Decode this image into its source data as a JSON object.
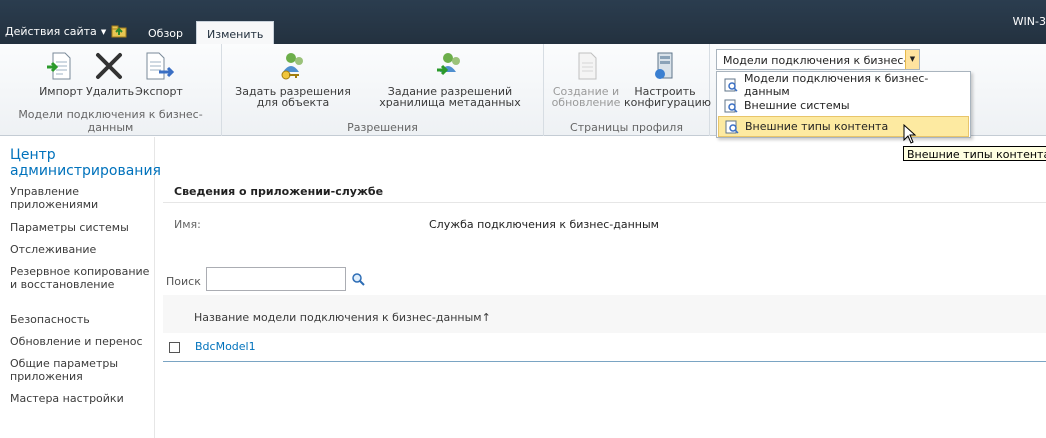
{
  "topbar": {
    "site_actions": "Действия сайта",
    "tabs": [
      {
        "label": "Обзор"
      },
      {
        "label": "Изменить"
      }
    ],
    "server_name": "WIN-3"
  },
  "ribbon": {
    "groups": {
      "models": {
        "title": "Модели подключения к бизнес-данным",
        "import": "Импорт",
        "delete": "Удалить",
        "export": "Экспорт"
      },
      "permissions": {
        "title": "Разрешения",
        "set_object": "Задать разрешения для объекта",
        "set_store": "Задание разрешений хранилища метаданных"
      },
      "profile_pages": {
        "title": "Страницы профиля",
        "create_update": "Создание и обновление",
        "configure": "Настроить конфигурацию"
      }
    },
    "view_select": {
      "value": "Модели подключения к бизнес-данным",
      "options": [
        "Модели подключения к бизнес-данным",
        "Внешние системы",
        "Внешние типы контента"
      ]
    },
    "tooltip": "Внешние типы контента"
  },
  "leftnav": {
    "heading": "Центр администрирования",
    "items": [
      "Управление приложениями",
      "Параметры системы",
      "Отслеживание",
      "Резервное копирование и восстановление",
      "Безопасность",
      "Обновление и перенос",
      "Общие параметры приложения",
      "Мастера настройки"
    ]
  },
  "main": {
    "section_title": "Сведения о приложении-службе",
    "name_label": "Имя:",
    "name_value": "Служба подключения к бизнес-данным",
    "search_label": "Поиск",
    "search_value": "",
    "column_header": "Название модели подключения к бизнес-данным↑",
    "rows": [
      {
        "name": "BdcModel1"
      }
    ]
  },
  "colors": {
    "topbar": "#2b3d4f",
    "link": "#0072bc",
    "selected": "#fdeaa1"
  }
}
